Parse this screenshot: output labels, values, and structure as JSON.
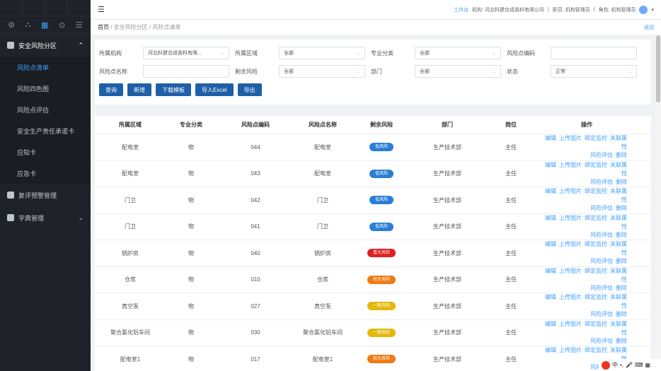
{
  "sidebar": {
    "groups": [
      {
        "label": "安全风险分区",
        "expanded": true,
        "items": [
          {
            "label": "风险点清单",
            "active": true
          },
          {
            "label": "风险四色图",
            "active": false
          },
          {
            "label": "风险点评估",
            "active": false
          },
          {
            "label": "安全生产责任承诺卡",
            "active": false
          },
          {
            "label": "应知卡",
            "active": false
          },
          {
            "label": "应急卡",
            "active": false
          }
        ]
      },
      {
        "label": "复评预警管理",
        "expanded": false,
        "items": []
      },
      {
        "label": "字典管理",
        "expanded": false,
        "items": []
      }
    ]
  },
  "header": {
    "workspace": "工作台",
    "org": "机构: 河北科健合成香料有限公司",
    "role_user": "职员: 机构管理员",
    "role": "角色: 机构管理员"
  },
  "breadcrumb": {
    "home": "首页",
    "level1": "安全风险分区",
    "level2": "风险点清单",
    "back": "返回"
  },
  "filter": {
    "org_label": "所属机构",
    "org_value": "河北科健合成香料有限...",
    "area_label": "所属区域",
    "area_value": "全部",
    "category_label": "专业分类",
    "category_value": "全部",
    "code_label": "风险点编码",
    "code_value": "",
    "name_label": "风险点名称",
    "name_value": "",
    "residual_label": "剩余风险",
    "residual_value": "全部",
    "dept_label": "部门",
    "dept_value": "全部",
    "status_label": "状态",
    "status_value": "正常",
    "buttons": [
      "查询",
      "新增",
      "下载模板",
      "导入Excel",
      "导出"
    ]
  },
  "table": {
    "headers": [
      "所属区域",
      "专业分类",
      "风险点编码",
      "风险点名称",
      "剩余风险",
      "部门",
      "岗位",
      "操作"
    ],
    "rows": [
      {
        "area": "配电室",
        "cat": "物",
        "code": "044",
        "name": "配电室",
        "risk": "低风险",
        "risk_color": "#2a7fd4",
        "dept": "生产技术部",
        "post": "主任"
      },
      {
        "area": "配电室",
        "cat": "物",
        "code": "043",
        "name": "配电室",
        "risk": "低风险",
        "risk_color": "#2a7fd4",
        "dept": "生产技术部",
        "post": "主任"
      },
      {
        "area": "门卫",
        "cat": "物",
        "code": "042",
        "name": "门卫",
        "risk": "低风险",
        "risk_color": "#2a7fd4",
        "dept": "生产技术部",
        "post": "主任"
      },
      {
        "area": "门卫",
        "cat": "物",
        "code": "041",
        "name": "门卫",
        "risk": "低风险",
        "risk_color": "#2a7fd4",
        "dept": "生产技术部",
        "post": "主任"
      },
      {
        "area": "锅炉房",
        "cat": "物",
        "code": "040",
        "name": "锅炉房",
        "risk": "重大风险",
        "risk_color": "#e02020",
        "dept": "生产技术部",
        "post": "主任"
      },
      {
        "area": "仓库",
        "cat": "物",
        "code": "010",
        "name": "仓库",
        "risk": "较大风险",
        "risk_color": "#f07a14",
        "dept": "生产技术部",
        "post": "主任"
      },
      {
        "area": "真空泵",
        "cat": "物",
        "code": "027",
        "name": "真空泵",
        "risk": "一般风险",
        "risk_color": "#e3b70d",
        "dept": "生产技术部",
        "post": "主任"
      },
      {
        "area": "聚合氯化铝车间",
        "cat": "物",
        "code": "030",
        "name": "聚合氯化铝车间",
        "risk": "一般风险",
        "risk_color": "#e3b70d",
        "dept": "生产技术部",
        "post": "主任"
      },
      {
        "area": "配电室1",
        "cat": "物",
        "code": "017",
        "name": "配电室1",
        "risk": "较大风险",
        "risk_color": "#f07a14",
        "dept": "生产技术部",
        "post": "主任"
      }
    ],
    "ops_line1": [
      "编辑",
      "上传图片",
      "绑定监控",
      "关联属性"
    ],
    "ops_line2": [
      "风险评估",
      "删除"
    ]
  }
}
